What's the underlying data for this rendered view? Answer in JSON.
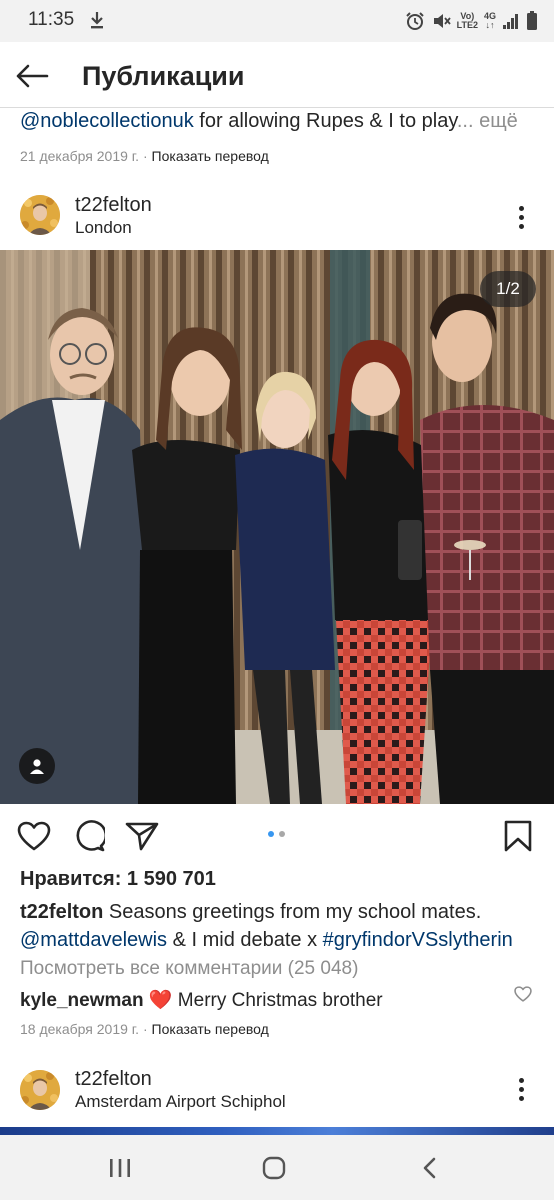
{
  "status_bar": {
    "time": "11:35",
    "network_label": "Vo) 4G\nLTE2",
    "icons": [
      "download-icon",
      "alarm-icon",
      "mute-icon",
      "signal-icon",
      "battery-icon"
    ]
  },
  "header": {
    "title": "Публикации",
    "back_icon": "arrow-left-icon"
  },
  "previous_post": {
    "mention": "@noblecollectionuk",
    "text": " for allowing Rupes & I to play",
    "ellipsis": "...",
    "more_label": " ещё",
    "date": "21 декабря 2019 г.",
    "separator": " · ",
    "translate_label": "Показать перевод"
  },
  "post": {
    "username": "t22felton",
    "location": "London",
    "carousel_counter": "1/2",
    "carousel_index": 1,
    "carousel_total": 2,
    "likes_label": "Нравится:",
    "likes_count": "1 590 701",
    "caption_user": "t22felton",
    "caption_text": " Seasons greetings from my school mates.",
    "caption_mention": "@mattdavelewis",
    "caption_middle": " & I mid debate x ",
    "caption_hashtag": "#gryfindorVSslytherin",
    "view_comments": "Посмотреть все комментарии (25 048)",
    "comment_user": "kyle_newman",
    "comment_emoji": "❤️",
    "comment_text": " Merry Christmas brother",
    "date": "18 декабря 2019 г.",
    "separator": " · ",
    "translate_label": "Показать перевод"
  },
  "next_post": {
    "username": "t22felton",
    "location": "Amsterdam Airport Schiphol"
  },
  "colors": {
    "link": "#00376b",
    "meta": "#8e8e8e",
    "text": "#262626",
    "dot_active": "#3897f0",
    "dot_inactive": "#a8a8a8"
  }
}
